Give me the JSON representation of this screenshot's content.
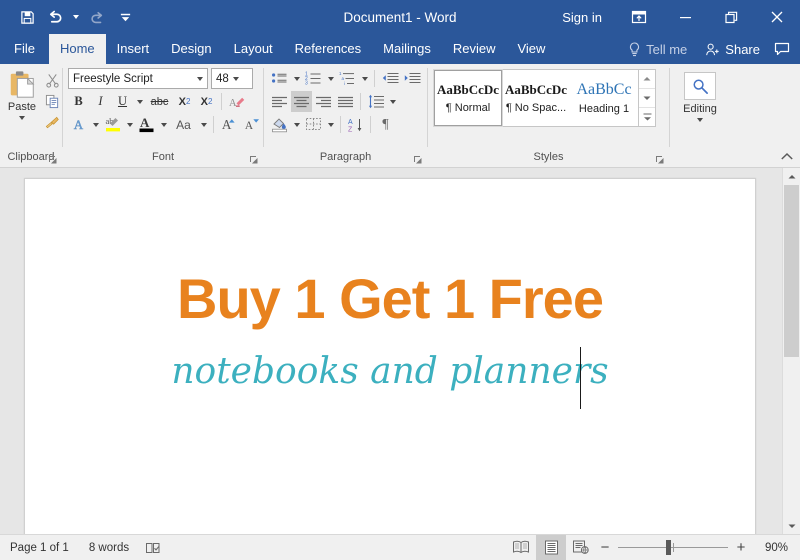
{
  "titlebar": {
    "title": "Document1  -  Word",
    "signin": "Sign in",
    "qat": [
      {
        "name": "save",
        "icon": "save-icon"
      },
      {
        "name": "undo",
        "icon": "undo-icon"
      },
      {
        "name": "redo",
        "icon": "redo-icon"
      },
      {
        "name": "customize-quick-access-toolbar",
        "icon": "chevron-down-icon"
      }
    ],
    "window": [
      {
        "name": "ribbon-display-options",
        "icon": "ribbon-display-options-icon"
      },
      {
        "name": "minimize",
        "icon": "minimize-icon"
      },
      {
        "name": "restore",
        "icon": "restore-icon"
      },
      {
        "name": "close",
        "icon": "close-icon"
      }
    ]
  },
  "tabs": [
    {
      "label": "File",
      "active": false
    },
    {
      "label": "Home",
      "active": true
    },
    {
      "label": "Insert",
      "active": false
    },
    {
      "label": "Design",
      "active": false
    },
    {
      "label": "Layout",
      "active": false
    },
    {
      "label": "References",
      "active": false
    },
    {
      "label": "Mailings",
      "active": false
    },
    {
      "label": "Review",
      "active": false
    },
    {
      "label": "View",
      "active": false
    }
  ],
  "tabs_right": {
    "tell_me": "Tell me",
    "share": "Share",
    "comments_icon": "comment-icon"
  },
  "ribbon": {
    "clipboard": {
      "label": "Clipboard",
      "paste_label": "Paste",
      "buttons": [
        "cut",
        "copy",
        "format-painter"
      ]
    },
    "font": {
      "label": "Font",
      "font_name": "Freestyle Script",
      "font_name_placeholder": "Font",
      "font_size": "48",
      "font_size_placeholder": "Size",
      "row1": [
        "Bold",
        "Italic",
        "Underline",
        "Strikethrough",
        "Subscript",
        "Superscript",
        "Clear All Formatting"
      ],
      "row2": [
        "Text Effects and Typography",
        "Text Highlight Color",
        "Font Color",
        "Change Case",
        "Increase Font Size",
        "Decrease Font Size"
      ],
      "bold_glyph": "B",
      "italic_glyph": "I",
      "underline_glyph": "U",
      "strike_glyph": "abc",
      "sub_glyph": "X",
      "sub_sup": "2",
      "sup_glyph": "X",
      "sup_sup": "2",
      "effects_glyph": "A",
      "case_glyph": "Aa",
      "grow_glyph": "A",
      "shrink_glyph": "A",
      "highlight_color": "#ffff00",
      "font_color": "#000000"
    },
    "paragraph": {
      "label": "Paragraph",
      "row1": [
        "Bullets",
        "Numbering",
        "Multilevel List",
        "Decrease Indent",
        "Increase Indent"
      ],
      "row2": [
        "Align Left",
        "Center",
        "Align Right",
        "Justify",
        "Line and Paragraph Spacing"
      ],
      "row3": [
        "Shading",
        "Borders",
        "Sort",
        "Show/Hide Formatting Marks"
      ],
      "active": "Center",
      "pilcrow": "¶"
    },
    "styles": {
      "label": "Styles",
      "items": [
        {
          "preview": "AaBbCcDc",
          "name": "¶ Normal",
          "selected": true,
          "heading": false
        },
        {
          "preview": "AaBbCcDc",
          "name": "¶ No Spac...",
          "selected": false,
          "heading": false
        },
        {
          "preview": "AaBbCc",
          "name": "Heading 1",
          "selected": false,
          "heading": true
        }
      ]
    },
    "editing": {
      "label": "Editing",
      "icon": "search-icon"
    },
    "collapse_ribbon": "collapse-ribbon-icon"
  },
  "document": {
    "line1": "Buy 1 Get 1 Free",
    "line1_color": "#e8821e",
    "line2": "notebooks and planners",
    "line2_color": "#3cb0bf"
  },
  "statusbar": {
    "page": "Page 1 of 1",
    "words": "8 words",
    "proofing_icon": "proofing-errors-icon",
    "views": [
      {
        "name": "read-mode",
        "active": false
      },
      {
        "name": "print-layout",
        "active": true
      },
      {
        "name": "web-layout",
        "active": false
      }
    ],
    "zoom_out": "−",
    "zoom_in": "+",
    "zoom": "90%"
  }
}
